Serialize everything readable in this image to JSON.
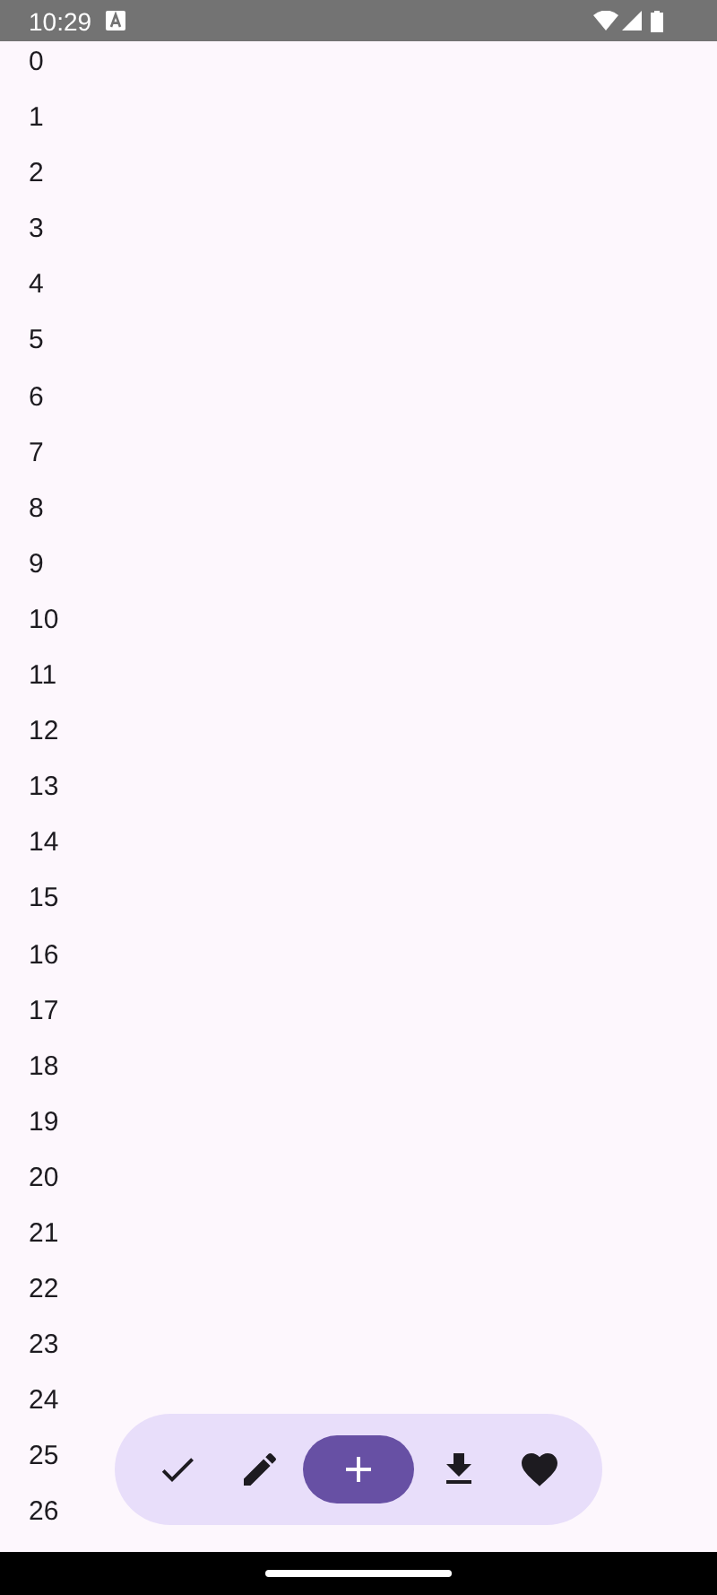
{
  "status_bar": {
    "time": "10:29"
  },
  "list": {
    "items": [
      "0",
      "1",
      "2",
      "3",
      "4",
      "5",
      "6",
      "7",
      "8",
      "9",
      "10",
      "11",
      "12",
      "13",
      "14",
      "15",
      "16",
      "17",
      "18",
      "19",
      "20",
      "21",
      "22",
      "23",
      "24",
      "25",
      "26"
    ]
  },
  "toolbar": {
    "items": [
      {
        "selected": false
      },
      {
        "selected": false
      },
      {
        "selected": true
      },
      {
        "selected": false
      },
      {
        "selected": false
      }
    ]
  }
}
